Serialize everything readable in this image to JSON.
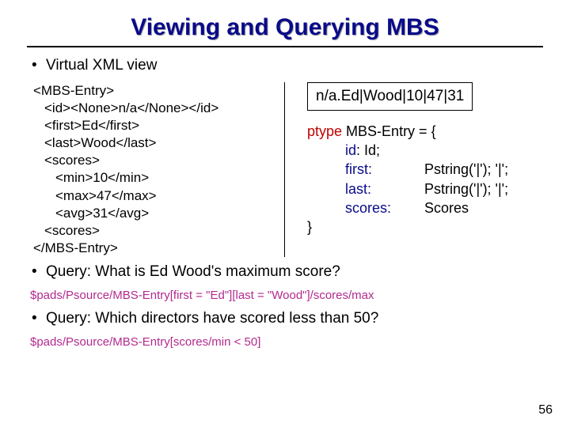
{
  "title": "Viewing and Querying MBS",
  "bullet1": "Virtual XML view",
  "xml": {
    "l0": "<MBS-Entry>",
    "l1": "<id><None>n/a</None></id>",
    "l2": "<first>Ed</first>",
    "l3": "<last>Wood</last>",
    "l4": "<scores>",
    "l5": "<min>10</min>",
    "l6": "<max>47</max>",
    "l7": "<avg>31</avg>",
    "l8": "<scores>",
    "l9": "</MBS-Entry>"
  },
  "boxed": "n/a.Ed|Wood|10|47|31",
  "ptype": {
    "head_kw": "ptype",
    "head_name": " MBS-Entry = {",
    "row_id_name": "id",
    "row_id_val": ": Id;",
    "row_first_name": "first",
    "row_first_val": "Pstring('|');  '|';",
    "row_last_name": "last",
    "row_last_val": "Pstring('|');  '|';",
    "row_scores_name": "scores",
    "row_scores_val": "Scores",
    "close": "}"
  },
  "bullet2": "Query: What is Ed Wood's maximum score?",
  "query1": "$pads/Psource/MBS-Entry[first = \"Ed\"][last = \"Wood\"]/scores/max",
  "bullet3": "Query: Which directors have scored less than 50?",
  "query2": "$pads/Psource/MBS-Entry[scores/min < 50]",
  "pagenum": "56"
}
